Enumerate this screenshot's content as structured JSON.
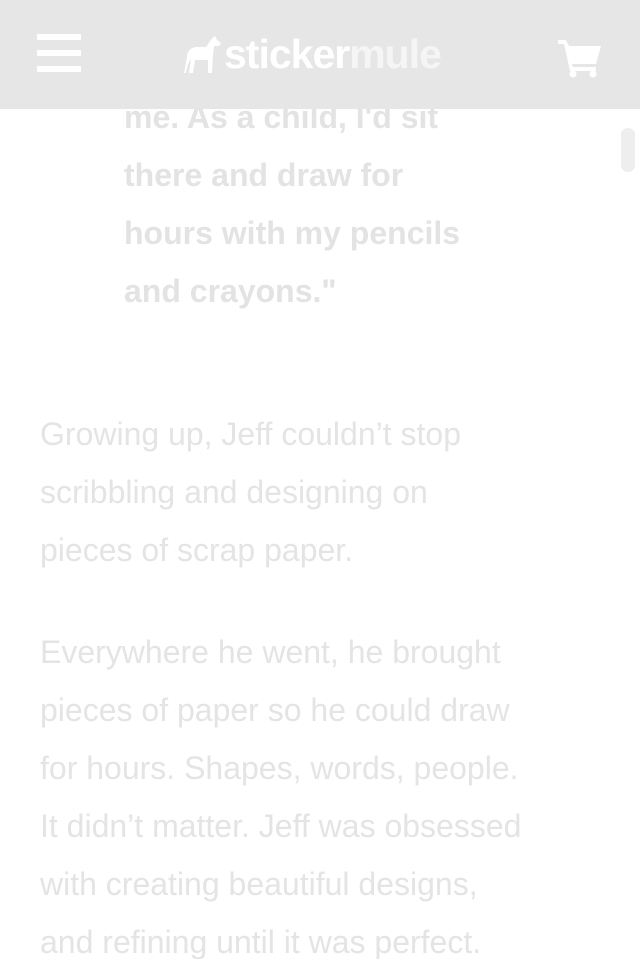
{
  "header": {
    "menu_icon": "hamburger-menu-icon",
    "logo": {
      "icon": "mule-icon",
      "word_part1": "sticker",
      "word_part2": "mule"
    },
    "cart_icon": "shopping-cart-icon"
  },
  "article": {
    "quote_lines": [
      "me. As a child, I'd sit",
      "there and draw for",
      "hours with my pencils",
      "and crayons.\""
    ],
    "paragraph1_lines": [
      "Growing up, Jeff couldn’t stop",
      "scribbling and designing on",
      "pieces of scrap paper."
    ],
    "paragraph2_lines": [
      "Everywhere he went, he brought",
      "pieces of paper so he could draw",
      "for hours. Shapes, words, people.",
      "It didn’t matter. Jeff was obsessed",
      "with creating beautiful designs,",
      "and refining until it was perfect."
    ]
  }
}
